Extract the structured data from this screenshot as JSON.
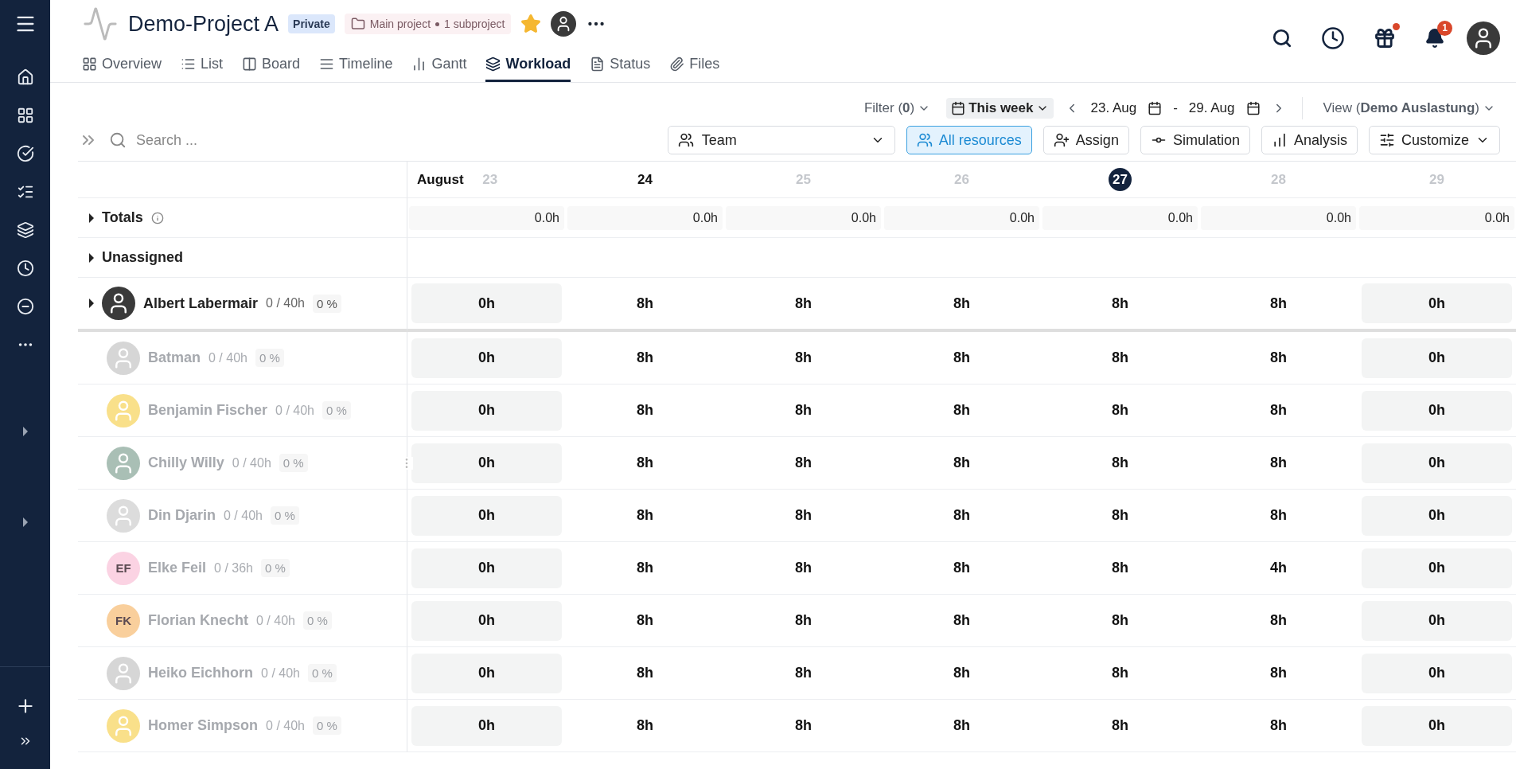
{
  "project": {
    "title": "Demo-Project A",
    "visibility": "Private",
    "hierarchy": [
      "Main project",
      "1 subproject"
    ],
    "favorite": true
  },
  "tabs": [
    {
      "label": "Overview",
      "selected": false
    },
    {
      "label": "List",
      "selected": false
    },
    {
      "label": "Board",
      "selected": false
    },
    {
      "label": "Timeline",
      "selected": false
    },
    {
      "label": "Gantt",
      "selected": false
    },
    {
      "label": "Workload",
      "selected": true
    },
    {
      "label": "Status",
      "selected": false
    },
    {
      "label": "Files",
      "selected": false
    }
  ],
  "header_actions": {
    "gift_unread": true,
    "notification_count": "1"
  },
  "toolbar": {
    "filter": "Filter (**0**)",
    "period": "This week",
    "range_start": "23. Aug",
    "range_separator": "-",
    "range_end": "29. Aug",
    "view": "View (**Demo Auslastung**)"
  },
  "search": {
    "placeholder": "Search ..."
  },
  "group_select": {
    "value": "Team"
  },
  "buttons": [
    {
      "label": "All resources",
      "selected": true
    },
    {
      "label": "Assign",
      "selected": false
    },
    {
      "label": "Simulation",
      "selected": false
    },
    {
      "label": "Analysis",
      "selected": false
    },
    {
      "label": "Customize",
      "selected": false
    }
  ],
  "grid": {
    "month": "August",
    "days": [
      {
        "label": "23",
        "kind": "muted",
        "off": true
      },
      {
        "label": "24",
        "kind": "bold",
        "off": false
      },
      {
        "label": "25",
        "kind": "muted",
        "off": false
      },
      {
        "label": "26",
        "kind": "muted",
        "off": false
      },
      {
        "label": "27",
        "kind": "today",
        "off": false
      },
      {
        "label": "28",
        "kind": "muted",
        "off": false
      },
      {
        "label": "29",
        "kind": "muted",
        "off": true
      }
    ],
    "totals_label": "Totals",
    "totals": [
      "0.0h",
      "0.0h",
      "0.0h",
      "0.0h",
      "0.0h",
      "0.0h",
      "0.0h"
    ],
    "unassigned_label": "Unassigned",
    "resources": [
      {
        "name": "Albert Labermair",
        "capacity": "0 / 40h",
        "utilization": "0 %",
        "dimmed": false,
        "expandable": true,
        "avatar": {
          "kind": "photo"
        },
        "hours": [
          "0h",
          "8h",
          "8h",
          "8h",
          "8h",
          "8h",
          "0h"
        ]
      },
      {
        "name": "Batman",
        "capacity": "0 / 40h",
        "utilization": "0 %",
        "dimmed": true,
        "expandable": false,
        "avatar": {
          "kind": "picture"
        },
        "hours": [
          "0h",
          "8h",
          "8h",
          "8h",
          "8h",
          "8h",
          "0h"
        ]
      },
      {
        "name": "Benjamin Fischer",
        "capacity": "0 / 40h",
        "utilization": "0 %",
        "dimmed": true,
        "expandable": false,
        "avatar": {
          "kind": "picture",
          "color": "#f9e08a"
        },
        "hours": [
          "0h",
          "8h",
          "8h",
          "8h",
          "8h",
          "8h",
          "0h"
        ]
      },
      {
        "name": "Chilly Willy",
        "capacity": "0 / 40h",
        "utilization": "0 %",
        "dimmed": true,
        "expandable": false,
        "avatar": {
          "kind": "picture",
          "color": "#a9bfb5"
        },
        "hours": [
          "0h",
          "8h",
          "8h",
          "8h",
          "8h",
          "8h",
          "0h"
        ]
      },
      {
        "name": "Din Djarin",
        "capacity": "0 / 40h",
        "utilization": "0 %",
        "dimmed": true,
        "expandable": false,
        "avatar": {
          "kind": "picture",
          "color": "#dcdcdc"
        },
        "hours": [
          "0h",
          "8h",
          "8h",
          "8h",
          "8h",
          "8h",
          "0h"
        ]
      },
      {
        "name": "Elke Feil",
        "capacity": "0 / 36h",
        "utilization": "0 %",
        "dimmed": true,
        "expandable": false,
        "avatar": {
          "kind": "initials",
          "text": "EF",
          "color": "#fbd3e3"
        },
        "hours": [
          "0h",
          "8h",
          "8h",
          "8h",
          "8h",
          "4h",
          "0h"
        ]
      },
      {
        "name": "Florian Knecht",
        "capacity": "0 / 40h",
        "utilization": "0 %",
        "dimmed": true,
        "expandable": false,
        "avatar": {
          "kind": "initials",
          "text": "FK",
          "color": "#f9cf9c"
        },
        "hours": [
          "0h",
          "8h",
          "8h",
          "8h",
          "8h",
          "8h",
          "0h"
        ]
      },
      {
        "name": "Heiko Eichhorn",
        "capacity": "0 / 40h",
        "utilization": "0 %",
        "dimmed": true,
        "expandable": false,
        "avatar": {
          "kind": "picture"
        },
        "hours": [
          "0h",
          "8h",
          "8h",
          "8h",
          "8h",
          "8h",
          "0h"
        ]
      },
      {
        "name": "Homer Simpson",
        "capacity": "0 / 40h",
        "utilization": "0 %",
        "dimmed": true,
        "expandable": false,
        "avatar": {
          "kind": "picture",
          "color": "#f9e08a"
        },
        "hours": [
          "0h",
          "8h",
          "8h",
          "8h",
          "8h",
          "8h",
          "0h"
        ]
      }
    ]
  }
}
